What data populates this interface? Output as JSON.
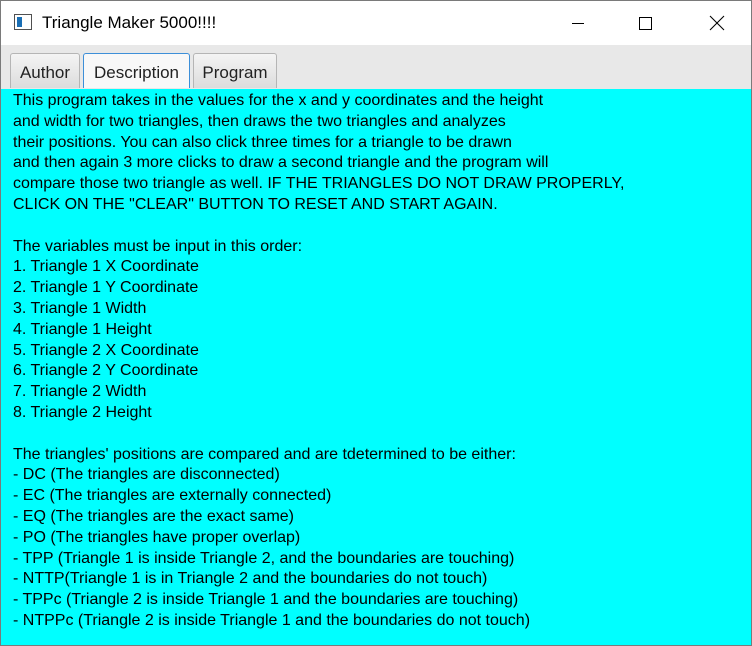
{
  "window": {
    "title": "Triangle Maker 5000!!!!",
    "controls": [
      "minimize",
      "maximize",
      "close"
    ]
  },
  "tabs": [
    {
      "label": "Author",
      "selected": false
    },
    {
      "label": "Description",
      "selected": true
    },
    {
      "label": "Program",
      "selected": false
    }
  ],
  "description": {
    "intro": "This program takes in the values for the x and y coordinates and the height\nand width for two triangles, then draws the two triangles and analyzes\ntheir positions. You can also click three times for a triangle to be drawn\nand then again 3 more clicks to draw a second triangle and the program will\ncompare those two triangle as well. IF THE TRIANGLES DO NOT DRAW PROPERLY,\nCLICK ON THE \"CLEAR\" BUTTON TO RESET AND START AGAIN.",
    "variables_heading": "The variables must be input in this order:",
    "variables": [
      "1. Triangle 1 X Coordinate",
      "2. Triangle 1 Y Coordinate",
      "3. Triangle 1 Width",
      "4. Triangle 1 Height",
      "5. Triangle 2 X Coordinate",
      "6. Triangle 2 Y Coordinate",
      "7. Triangle 2 Width",
      "8. Triangle 2 Height"
    ],
    "positions_heading": "The triangles' positions are compared and are tdetermined to be either:",
    "positions": [
      "- DC (The triangles are disconnected)",
      "- EC (The triangles are externally connected)",
      "- EQ (The triangles are the exact same)",
      "- PO (The triangles have proper overlap)",
      "- TPP (Triangle 1 is inside Triangle 2, and the boundaries are touching)",
      "- NTTP(Triangle 1 is in Triangle 2 and the boundaries do not touch)",
      "- TPPc (Triangle 2 is inside Triangle 1 and the boundaries are touching)",
      "- NTPPc (Triangle 2 is inside Triangle 1 and the boundaries do not touch)"
    ]
  },
  "colors": {
    "content_background": "#00ffff",
    "tab_focus_border": "#3d8fd8"
  }
}
